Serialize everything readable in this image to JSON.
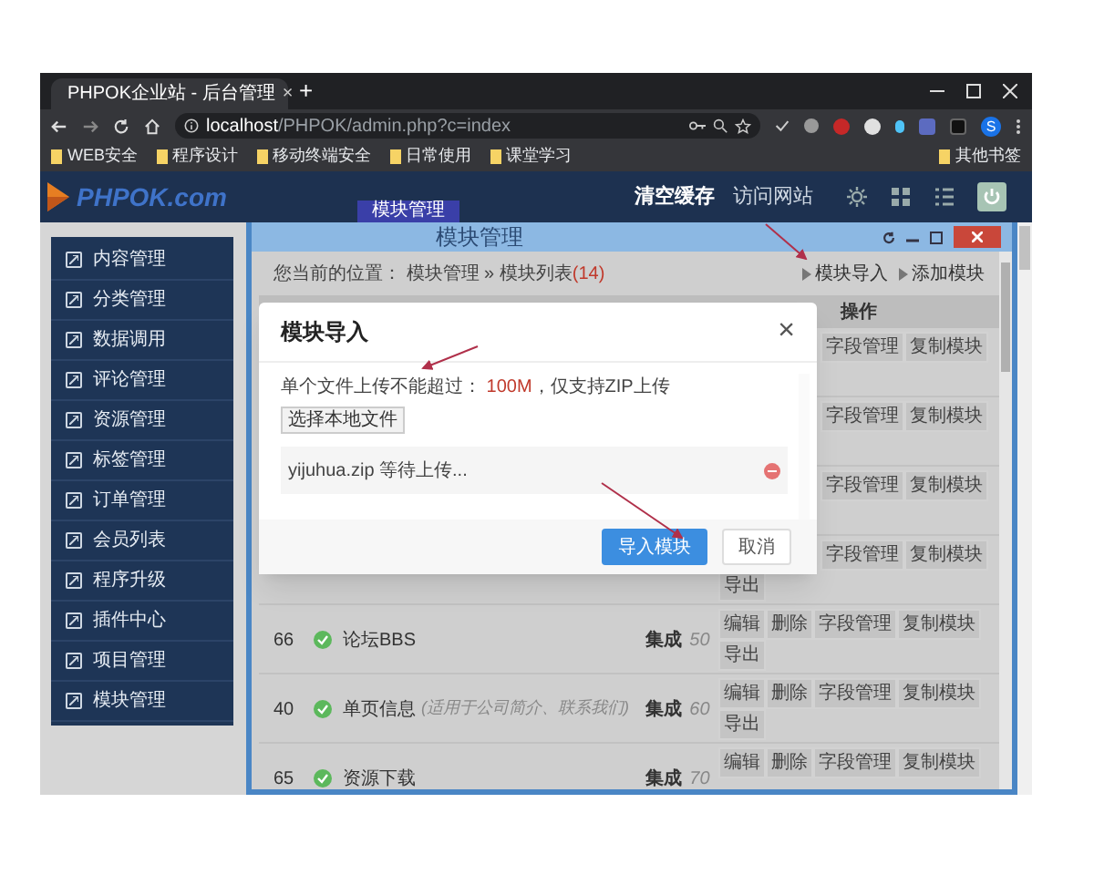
{
  "browser": {
    "tab_title": "PHPOK企业站 - 后台管理",
    "tab_close": "×",
    "new_tab": "+",
    "url_host": "localhost",
    "url_path": "/PHPOK/admin.php?c=index",
    "profile": "S",
    "bookmarks": [
      "WEB安全",
      "程序设计",
      "移动终端安全",
      "日常使用",
      "课堂学习"
    ],
    "other_bookmarks": "其他书签"
  },
  "header": {
    "logo": "PHPOK.com",
    "nav_tab": "模块管理",
    "links": [
      "清空缓存",
      "访问网站"
    ]
  },
  "sidebar": {
    "items": [
      "内容管理",
      "分类管理",
      "数据调用",
      "评论管理",
      "资源管理",
      "标签管理",
      "订单管理",
      "会员列表",
      "程序升级",
      "插件中心",
      "项目管理",
      "模块管理"
    ]
  },
  "panel": {
    "title": "模块管理",
    "breadcrumb_label": "您当前的位置：",
    "breadcrumb": "模块管理 » 模块列表",
    "count": "(14)",
    "actions": [
      "模块导入",
      "添加模块"
    ]
  },
  "table": {
    "columns": [
      {
        "label": "操作"
      }
    ],
    "rows": [
      {
        "kind": "covered",
        "actions": [
          "字段管理",
          "复制模块"
        ]
      },
      {
        "kind": "covered",
        "actions": [
          "字段管理",
          "复制模块"
        ]
      },
      {
        "kind": "covered",
        "actions": [
          "字段管理",
          "复制模块"
        ]
      },
      {
        "kind": "covered",
        "actions": [
          "字段管理",
          "复制模块"
        ],
        "actions_line2": [
          "导出"
        ]
      },
      {
        "kind": "full",
        "id": "66",
        "enabled": true,
        "name": "论坛BBS",
        "type": "集成",
        "sort": "50",
        "actions": [
          "编辑",
          "删除",
          "字段管理",
          "复制模块",
          "导出"
        ]
      },
      {
        "kind": "full",
        "id": "40",
        "enabled": true,
        "name": "单页信息",
        "note": "(适用于公司简介、联系我们)",
        "type": "集成",
        "sort": "60",
        "actions": [
          "编辑",
          "删除",
          "字段管理",
          "复制模块",
          "导出"
        ]
      },
      {
        "kind": "full",
        "id": "65",
        "enabled": true,
        "name": "资源下载",
        "type": "集成",
        "sort": "70",
        "actions": [
          "编辑",
          "删除",
          "字段管理",
          "复制模块"
        ]
      }
    ]
  },
  "dialog": {
    "title": "模块导入",
    "close": "×",
    "limit_prefix": "单个文件上传不能超过：",
    "limit_value": "100M",
    "limit_suffix": "，仅支持ZIP上传",
    "choose_button": "选择本地文件",
    "file": "yijuhua.zip 等待上传...",
    "buttons": [
      {
        "label": "导入模块",
        "kind": "primary"
      },
      {
        "label": "取消",
        "kind": "secondary"
      }
    ]
  }
}
